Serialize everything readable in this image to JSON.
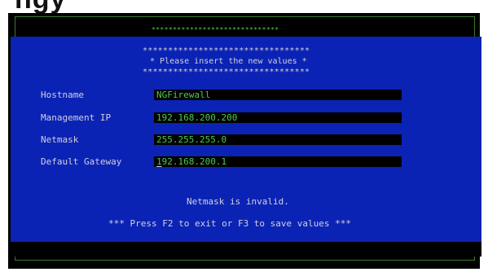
{
  "cut_title": "ngy",
  "top_stars": "******************************",
  "header": {
    "line1": "*********************************",
    "line2": "* Please insert the new values *",
    "line3": "*********************************"
  },
  "fields": [
    {
      "label": "Hostname",
      "value": "NGFirewall"
    },
    {
      "label": "Management IP",
      "value": "192.168.200.200"
    },
    {
      "label": "Netmask",
      "value": "255.255.255.0"
    },
    {
      "label": "Default Gateway",
      "value_first": "1",
      "value_rest": "92.168.200.1"
    }
  ],
  "error_message": "Netmask is invalid.",
  "help_message": "*** Press F2 to exit or F3 to save values ***",
  "colors": {
    "panel_blue": "#0b23b4",
    "field_green": "#4ccc4c",
    "text_gray": "#d0d0e0"
  }
}
